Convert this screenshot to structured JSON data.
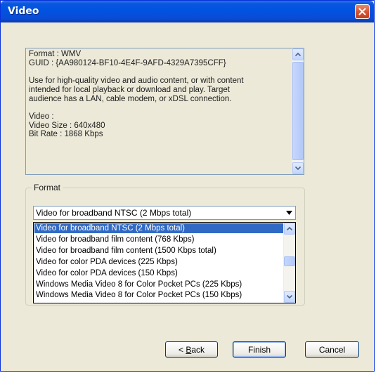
{
  "window": {
    "title": "Video"
  },
  "info": {
    "lines": [
      "Format : WMV",
      "GUID : {AA980124-BF10-4E4F-9AFD-4329A7395CFF}",
      "",
      "Use for high-quality video and audio content, or with content",
      "intended for local playback or download and play. Target",
      "audience has a LAN, cable modem, or xDSL connection.",
      "",
      "Video :",
      "Video Size : 640x480",
      "Bit Rate : 1868 Kbps"
    ]
  },
  "format_group": {
    "legend": "Format",
    "selected": "Video for broadband NTSC (2 Mbps total)",
    "options": [
      "Video for broadband NTSC (2 Mbps total)",
      "Video for broadband film content (768 Kbps)",
      "Video for broadband film content (1500 Kbps total)",
      "Video for color PDA devices (225 Kbps)",
      "Video for color PDA devices (150 Kbps)",
      "Windows Media Video 8 for Color Pocket PCs (225 Kbps)",
      "Windows Media Video 8 for Color Pocket PCs (150 Kbps)"
    ],
    "highlighted_index": 0
  },
  "buttons": {
    "back_prefix": "< ",
    "back_accel": "B",
    "back_rest": "ack",
    "finish": "Finish",
    "cancel": "Cancel"
  },
  "icons": {
    "close": "close-icon",
    "scroll_up": "arrow-up-icon",
    "scroll_down": "arrow-down-icon",
    "combo_dropdown": "chevron-down-icon"
  }
}
